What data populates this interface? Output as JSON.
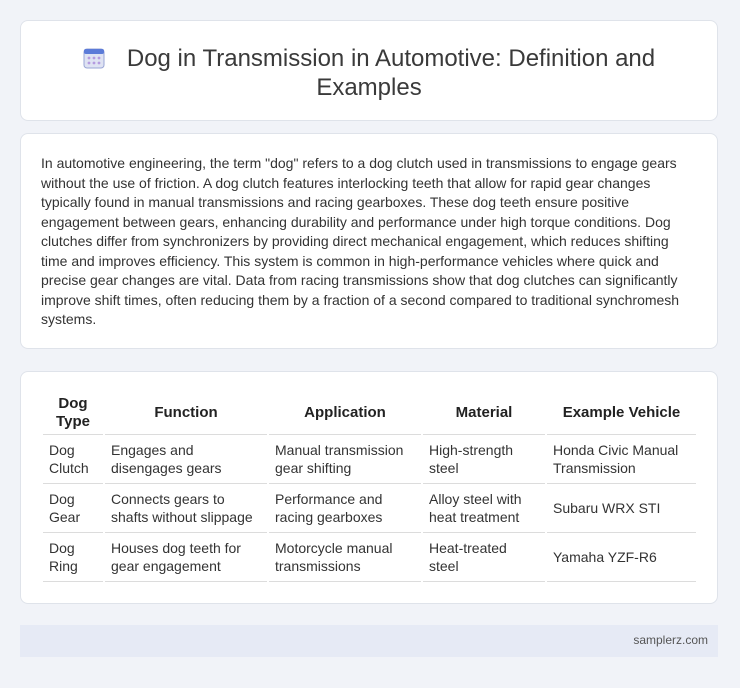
{
  "header": {
    "icon": "calendar-icon",
    "title": "Dog in Transmission in Automotive: Definition and Examples"
  },
  "intro": {
    "text": "In automotive engineering, the term \"dog\" refers to a dog clutch used in transmissions to engage gears without the use of friction. A dog clutch features interlocking teeth that allow for rapid gear changes typically found in manual transmissions and racing gearboxes. These dog teeth ensure positive engagement between gears, enhancing durability and performance under high torque conditions. Dog clutches differ from synchronizers by providing direct mechanical engagement, which reduces shifting time and improves efficiency. This system is common in high-performance vehicles where quick and precise gear changes are vital. Data from racing transmissions show that dog clutches can significantly improve shift times, often reducing them by a fraction of a second compared to traditional synchromesh systems."
  },
  "table": {
    "headers": [
      "Dog Type",
      "Function",
      "Application",
      "Material",
      "Example Vehicle"
    ],
    "rows": [
      [
        "Dog Clutch",
        "Engages and disengages gears",
        "Manual transmission gear shifting",
        "High-strength steel",
        "Honda Civic Manual Transmission"
      ],
      [
        "Dog Gear",
        "Connects gears to shafts without slippage",
        "Performance and racing gearboxes",
        "Alloy steel with heat treatment",
        "Subaru WRX STI"
      ],
      [
        "Dog Ring",
        "Houses dog teeth for gear engagement",
        "Motorcycle manual transmissions",
        "Heat-treated steel",
        "Yamaha YZF-R6"
      ]
    ]
  },
  "footer": {
    "site": "samplerz.com"
  }
}
